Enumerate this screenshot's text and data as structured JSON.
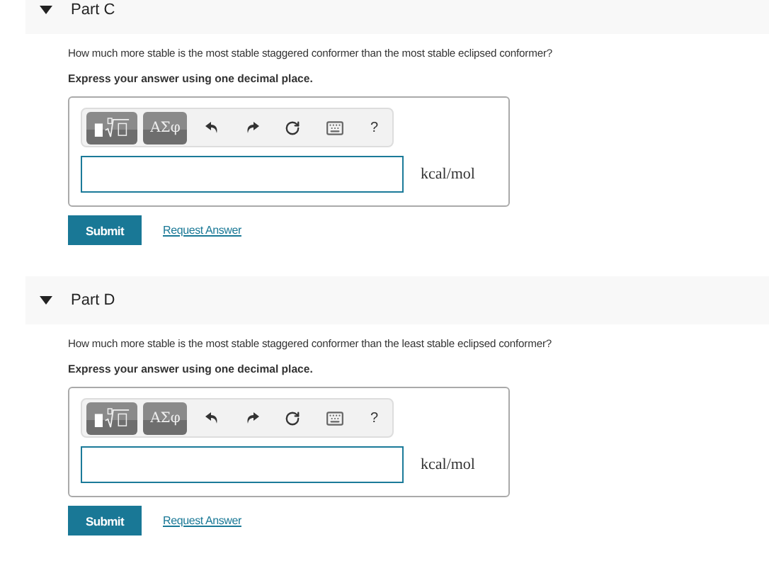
{
  "parts": [
    {
      "title": "Part C",
      "expanded": true,
      "question": "How much more stable is the most stable staggered conformer than the most stable eclipsed conformer?",
      "instruction": "Express your answer using one decimal place.",
      "symbols_label": "ΑΣφ",
      "help_label": "?",
      "unit": "kcal/mol",
      "submit": "Submit",
      "request": "Request Answer"
    },
    {
      "title": "Part D",
      "expanded": true,
      "question": "How much more stable is the most stable staggered conformer than the least stable eclipsed conformer?",
      "instruction": "Express your answer using one decimal place.",
      "symbols_label": "ΑΣφ",
      "help_label": "?",
      "unit": "kcal/mol",
      "submit": "Submit",
      "request": "Request Answer"
    }
  ]
}
